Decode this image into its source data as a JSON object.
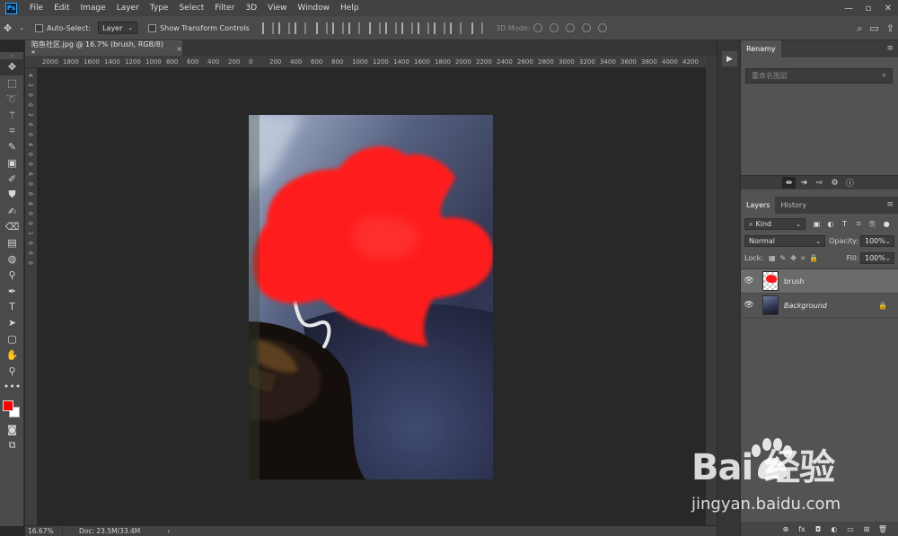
{
  "app": {
    "logo": "Ps"
  },
  "menu": [
    "File",
    "Edit",
    "Image",
    "Layer",
    "Type",
    "Select",
    "Filter",
    "3D",
    "View",
    "Window",
    "Help"
  ],
  "window_controls": [
    "—",
    "▫",
    "✕"
  ],
  "options": {
    "auto_select_label": "Auto-Select:",
    "auto_select_value": "Layer",
    "transform_label": "Show Transform Controls",
    "mode3d_label": "3D Mode:"
  },
  "document": {
    "tab_title": "陷鱼社区.jpg @ 16.7% (brush, RGB/8) *",
    "close": "×"
  },
  "ruler": {
    "h_labels": [
      "2000",
      "1800",
      "1600",
      "1400",
      "1200",
      "1000",
      "800",
      "600",
      "400",
      "200",
      "0",
      "200",
      "400",
      "600",
      "800",
      "1000",
      "1200",
      "1400",
      "1600",
      "1800",
      "2000",
      "2200",
      "2400",
      "2600",
      "2800",
      "3000",
      "3200",
      "3400",
      "3600",
      "3800",
      "4000",
      "4200"
    ],
    "v_labels": [
      "4",
      "2",
      "0",
      "0",
      "2",
      "0",
      "0",
      "4",
      "0",
      "0",
      "6",
      "0",
      "0",
      "8",
      "0",
      "0",
      "1",
      "0",
      "0",
      "0"
    ]
  },
  "status": {
    "zoom": "16.67%",
    "doc_size": "Doc: 23.5M/33.4M",
    "arrow": "›"
  },
  "renamy": {
    "tab": "Renamy",
    "search_placeholder": "重命名图层",
    "menu": "≡"
  },
  "layers_panel": {
    "tabs": [
      "Layers",
      "History"
    ],
    "filter_kind": "Kind",
    "blend_mode": "Normal",
    "opacity_label": "Opacity:",
    "opacity_value": "100%",
    "lock_label": "Lock:",
    "fill_label": "Fill:",
    "fill_value": "100%",
    "layers": [
      {
        "name": "brush",
        "visible": true,
        "selected": true,
        "locked": false
      },
      {
        "name": "Background",
        "visible": true,
        "selected": false,
        "locked": true
      }
    ],
    "footer_icons": [
      "link-icon",
      "fx-icon",
      "mask-icon",
      "adjustment-icon",
      "group-icon",
      "new-layer-icon",
      "trash-icon"
    ],
    "footer_labels": [
      "⊕",
      "fx",
      "◘",
      "◐",
      "▭",
      "⊞",
      "🗑"
    ]
  },
  "watermark": {
    "logo_text": "Bai  经验",
    "url": "jingyan.baidu.com"
  },
  "colors": {
    "foreground": "#ff0000",
    "background": "#ffffff",
    "accent": "#31a8ff"
  }
}
